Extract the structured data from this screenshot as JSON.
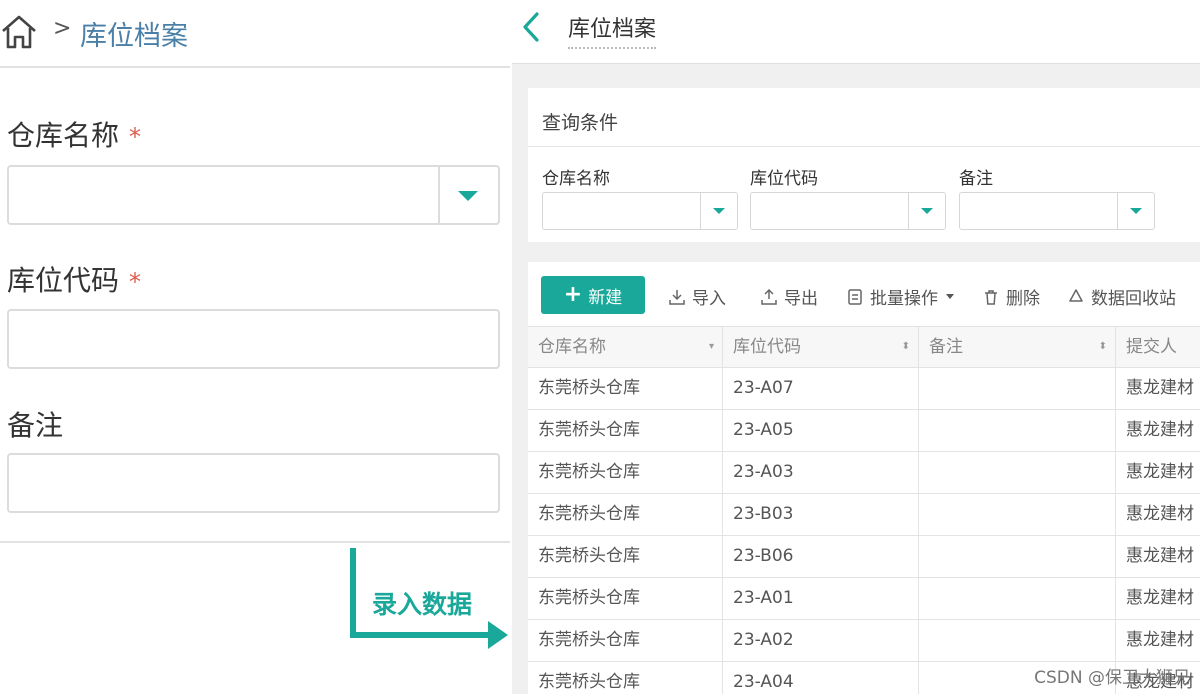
{
  "form": {
    "breadcrumb_sep": ">",
    "breadcrumb_title": "库位档案",
    "fields": [
      {
        "label": "仓库名称",
        "required": "*"
      },
      {
        "label": "库位代码",
        "required": "*"
      },
      {
        "label": "备注"
      }
    ]
  },
  "annotation": {
    "text": "录入数据"
  },
  "list": {
    "title": "库位档案",
    "query": {
      "title": "查询条件",
      "labels": [
        "仓库名称",
        "库位代码",
        "备注"
      ]
    },
    "toolbar": {
      "new_label": "新建",
      "import_label": "导入",
      "export_label": "导出",
      "batch_label": "批量操作",
      "delete_label": "删除",
      "recycle_label": "数据回收站"
    },
    "columns": [
      "仓库名称",
      "库位代码",
      "备注",
      "提交人"
    ],
    "rows": [
      [
        "东莞桥头仓库",
        "23-A07",
        "",
        "惠龙建材"
      ],
      [
        "东莞桥头仓库",
        "23-A05",
        "",
        "惠龙建材"
      ],
      [
        "东莞桥头仓库",
        "23-A03",
        "",
        "惠龙建材"
      ],
      [
        "东莞桥头仓库",
        "23-B03",
        "",
        "惠龙建材"
      ],
      [
        "东莞桥头仓库",
        "23-B06",
        "",
        "惠龙建材"
      ],
      [
        "东莞桥头仓库",
        "23-A01",
        "",
        "惠龙建材"
      ],
      [
        "东莞桥头仓库",
        "23-A02",
        "",
        "惠龙建材"
      ],
      [
        "东莞桥头仓库",
        "23-A04",
        "",
        "惠龙建材"
      ]
    ]
  },
  "watermark": "CSDN @保卫大狮兄",
  "colors": {
    "accent": "#1aa89a",
    "link": "#4a7fa8",
    "required": "#e05a4d"
  }
}
